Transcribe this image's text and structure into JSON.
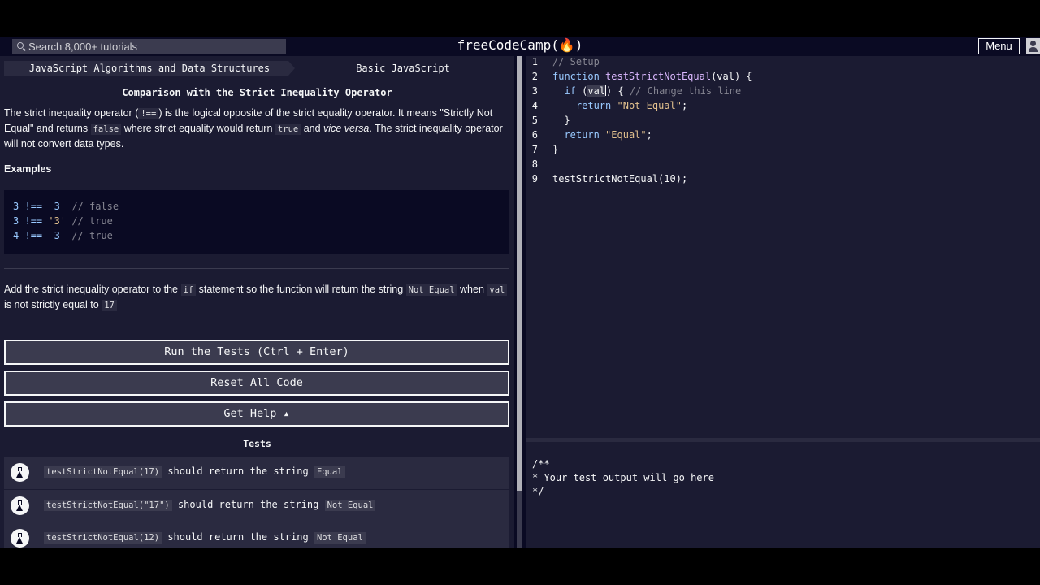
{
  "nav": {
    "search_placeholder": "Search 8,000+ tutorials",
    "logo": "freeCodeCamp(🔥)",
    "menu_label": "Menu"
  },
  "breadcrumbs": [
    "JavaScript Algorithms and Data Structures",
    "Basic JavaScript"
  ],
  "challenge": {
    "title": "Comparison with the Strict Inequality Operator",
    "description": {
      "p1_a": "The strict inequality operator (",
      "p1_code1": "!==",
      "p1_b": ") is the logical opposite of the strict equality operator. It means \"Strictly Not Equal\" and returns",
      "p1_code2": "false",
      "p1_c": "where strict equality would return",
      "p1_code3": "true",
      "p1_d": "and",
      "p1_em": "vice versa",
      "p1_e": ". The strict inequality operator will not convert data types."
    },
    "examples_heading": "Examples",
    "examples": [
      {
        "left": "3",
        "op": "!==",
        "right": " 3 ",
        "right_type": "num",
        "comment": "// false"
      },
      {
        "left": "3",
        "op": "!==",
        "right": "'3'",
        "right_type": "str",
        "comment": "// true"
      },
      {
        "left": "4",
        "op": "!==",
        "right": " 3 ",
        "right_type": "num",
        "comment": "// true"
      }
    ],
    "instructions": {
      "a": "Add the strict inequality operator to the",
      "code1": "if",
      "b": "statement so the function will return the string",
      "code2": "Not Equal",
      "c": "when",
      "code3": "val",
      "d": "is not strictly equal to",
      "code4": "17"
    }
  },
  "buttons": {
    "run": "Run the Tests (Ctrl + Enter)",
    "reset": "Reset All Code",
    "help": "Get Help ▴"
  },
  "tests": {
    "heading": "Tests",
    "items": [
      {
        "call": "testStrictNotEqual(17)",
        "text": "should return the string",
        "expected": "Equal"
      },
      {
        "call": "testStrictNotEqual(\"17\")",
        "text": "should return the string",
        "expected": "Not Equal"
      },
      {
        "call": "testStrictNotEqual(12)",
        "text": "should return the string",
        "expected": "Not Equal"
      }
    ]
  },
  "editor": {
    "line_numbers": [
      "1",
      "2",
      "3",
      "4",
      "5",
      "6",
      "7",
      "8",
      "9"
    ],
    "lines": {
      "l1": "// Setup",
      "l2_kw": "function",
      "l2_fn": "testStrictNotEqual",
      "l2_rest": "(val) {",
      "l3_kw": "if",
      "l3_open": " (",
      "l3_sel": "val",
      "l3_close": ") { ",
      "l3_cm": "// Change this line",
      "l4_kw": "return",
      "l4_st": "\"Not Equal\"",
      "l4_end": ";",
      "l5": "}",
      "l6_kw": "return",
      "l6_st": "\"Equal\"",
      "l6_end": ";",
      "l7": "}",
      "l9_fn": "testStrictNotEqual",
      "l9_rest": "(10);"
    }
  },
  "output": {
    "lines": [
      "/**",
      "* Your test output will go here",
      "*/"
    ]
  }
}
